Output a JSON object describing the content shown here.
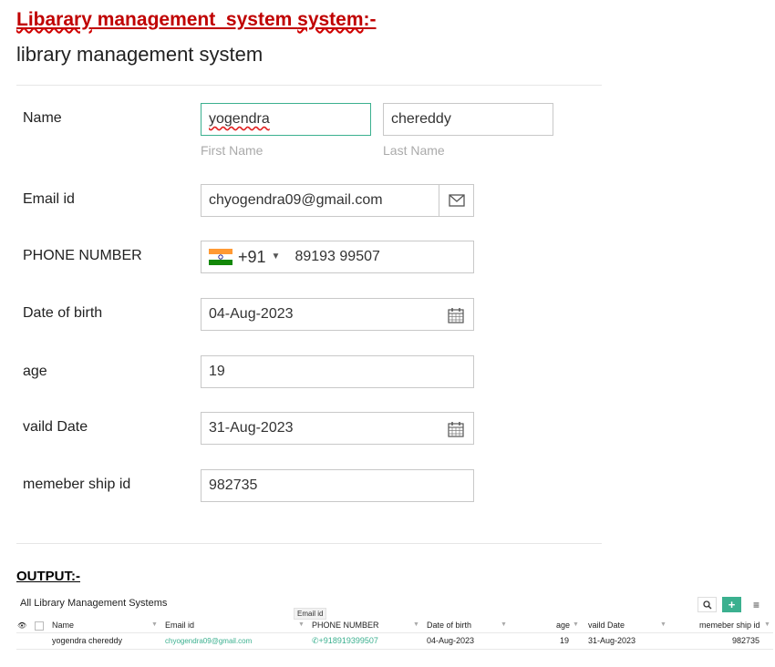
{
  "doc": {
    "heading_part1": "Libarary",
    "heading_part2": " management  system ",
    "heading_part3": "system",
    "heading_part4": ":-",
    "form_title": "library management system"
  },
  "form": {
    "name_label": "Name",
    "first_name_value": "yogendra",
    "last_name_value": "chereddy",
    "first_name_sub": "First Name",
    "last_name_sub": "Last Name",
    "email_label": "Email id",
    "email_value": "chyogendra09@gmail.com",
    "phone_label": "PHONE NUMBER",
    "phone_code": "+91",
    "phone_value": "89193 99507",
    "dob_label": "Date of birth",
    "dob_value": "04-Aug-2023",
    "age_label": "age",
    "age_value": "19",
    "valid_label": "vaild Date",
    "valid_value": "31-Aug-2023",
    "member_label": "memeber ship id",
    "member_value": "982735"
  },
  "output": {
    "heading": "OUTPUT:-",
    "list_title": "All Library Management Systems",
    "tooltip": "Email id",
    "columns": [
      "Name",
      "Email id",
      "PHONE NUMBER",
      "Date of birth",
      "age",
      "vaild Date",
      "memeber ship id"
    ],
    "rows": [
      [
        "yogendra chereddy",
        "chyogendra09@gmail.com",
        "+918919399507",
        "04-Aug-2023",
        "19",
        "31-Aug-2023",
        "982735"
      ]
    ]
  },
  "colors": {
    "heading_red": "#c00000",
    "accent_green": "#3bb08f"
  },
  "icons": [
    "envelope-icon",
    "calendar-icon",
    "india-flag-icon",
    "search-icon",
    "plus-icon",
    "menu-icon",
    "eye-icon",
    "phone-icon"
  ]
}
